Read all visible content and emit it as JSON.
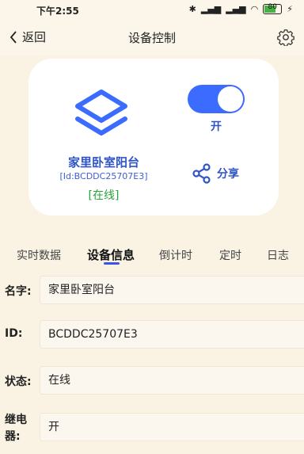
{
  "status_bar": {
    "time": "下午2:55",
    "battery": "80"
  },
  "nav": {
    "back_label": "返回",
    "title": "设备控制"
  },
  "device": {
    "name": "家里卧室阳台",
    "id_text": "[Id:BCDDC25707E3]",
    "status": "[在线]",
    "switch_label": "开",
    "switch_on": true
  },
  "share": {
    "label": "分享"
  },
  "tabs": [
    "实时数据",
    "设备信息",
    "倒计时",
    "定时",
    "日志"
  ],
  "active_tab": 1,
  "info": [
    {
      "label": "名字:",
      "value": "家里卧室阳台"
    },
    {
      "label": "ID:",
      "value": "BCDDC25707E3"
    },
    {
      "label": "状态:",
      "value": "在线"
    },
    {
      "label": "继电器:",
      "value": "开"
    }
  ],
  "colors": {
    "accent": "#3b6cff",
    "online": "#27a43a",
    "background": "#faf3e4"
  }
}
